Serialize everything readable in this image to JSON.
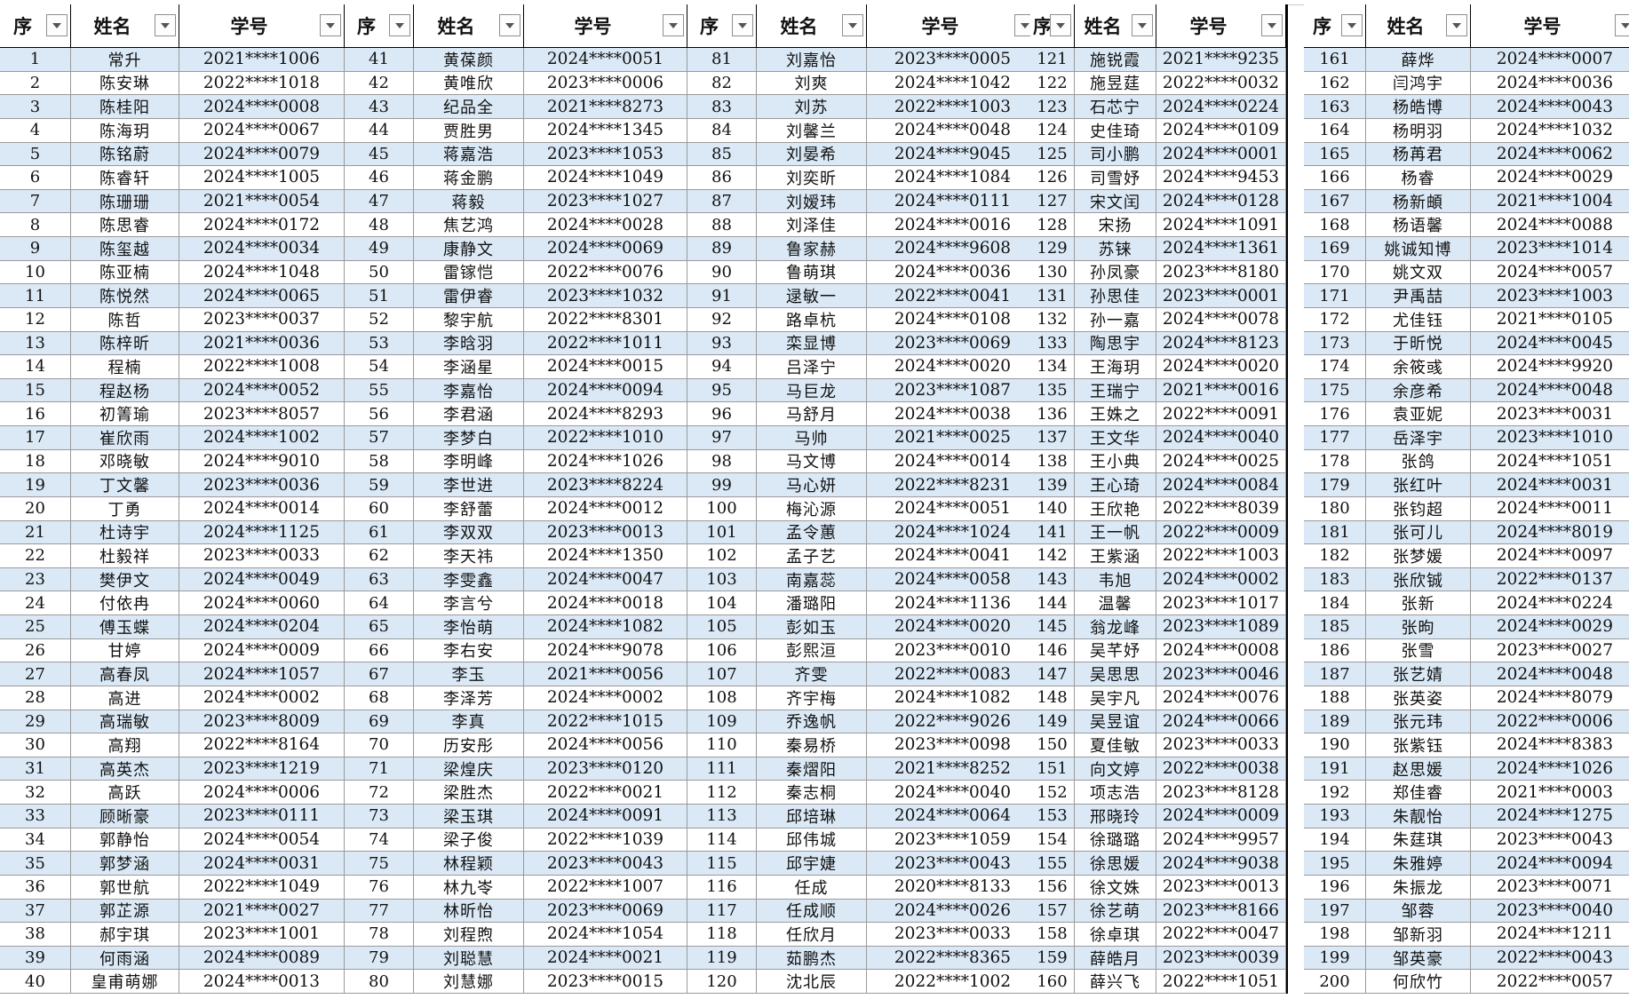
{
  "header": {
    "seq": "序",
    "name": "姓名",
    "id": "学号"
  },
  "accent": {
    "alt_row": "#dbe9f6",
    "border": "#000000"
  },
  "columns": [
    {
      "rows": [
        [
          "1",
          "常升",
          "2021****1006"
        ],
        [
          "2",
          "陈安琳",
          "2022****1018"
        ],
        [
          "3",
          "陈桂阳",
          "2024****0008"
        ],
        [
          "4",
          "陈海玥",
          "2024****0067"
        ],
        [
          "5",
          "陈铭蔚",
          "2024****0079"
        ],
        [
          "6",
          "陈睿轩",
          "2024****1005"
        ],
        [
          "7",
          "陈珊珊",
          "2021****0054"
        ],
        [
          "8",
          "陈思睿",
          "2024****0172"
        ],
        [
          "9",
          "陈玺越",
          "2024****0034"
        ],
        [
          "10",
          "陈亚楠",
          "2024****1048"
        ],
        [
          "11",
          "陈悦然",
          "2024****0065"
        ],
        [
          "12",
          "陈哲",
          "2023****0037"
        ],
        [
          "13",
          "陈梓昕",
          "2021****0036"
        ],
        [
          "14",
          "程楠",
          "2022****1008"
        ],
        [
          "15",
          "程赵杨",
          "2024****0052"
        ],
        [
          "16",
          "初箐瑜",
          "2023****8057"
        ],
        [
          "17",
          "崔欣雨",
          "2024****1002"
        ],
        [
          "18",
          "邓晓敏",
          "2024****9010"
        ],
        [
          "19",
          "丁文馨",
          "2023****0036"
        ],
        [
          "20",
          "丁勇",
          "2024****0014"
        ],
        [
          "21",
          "杜诗宇",
          "2024****1125"
        ],
        [
          "22",
          "杜毅祥",
          "2023****0033"
        ],
        [
          "23",
          "樊伊文",
          "2024****0049"
        ],
        [
          "24",
          "付依冉",
          "2024****0060"
        ],
        [
          "25",
          "傅玉蝶",
          "2024****0204"
        ],
        [
          "26",
          "甘婷",
          "2024****0009"
        ],
        [
          "27",
          "高春凤",
          "2024****1057"
        ],
        [
          "28",
          "高进",
          "2024****0002"
        ],
        [
          "29",
          "高瑞敏",
          "2023****8009"
        ],
        [
          "30",
          "高翔",
          "2022****8164"
        ],
        [
          "31",
          "高英杰",
          "2023****1219"
        ],
        [
          "32",
          "高跃",
          "2024****0006"
        ],
        [
          "33",
          "顾晰豪",
          "2023****0111"
        ],
        [
          "34",
          "郭静怡",
          "2024****0054"
        ],
        [
          "35",
          "郭梦涵",
          "2024****0031"
        ],
        [
          "36",
          "郭世航",
          "2022****1049"
        ],
        [
          "37",
          "郭芷源",
          "2021****0027"
        ],
        [
          "38",
          "郝宇琪",
          "2023****1001"
        ],
        [
          "39",
          "何雨涵",
          "2024****0089"
        ],
        [
          "40",
          "皇甫萌娜",
          "2024****0013"
        ]
      ]
    },
    {
      "rows": [
        [
          "41",
          "黄葆颜",
          "2024****0051"
        ],
        [
          "42",
          "黄唯欣",
          "2023****0006"
        ],
        [
          "43",
          "纪品全",
          "2021****8273"
        ],
        [
          "44",
          "贾胜男",
          "2024****1345"
        ],
        [
          "45",
          "蒋嘉浩",
          "2023****1053"
        ],
        [
          "46",
          "蒋金鹏",
          "2024****1049"
        ],
        [
          "47",
          "蒋毅",
          "2023****1027"
        ],
        [
          "48",
          "焦艺鸿",
          "2024****0028"
        ],
        [
          "49",
          "康静文",
          "2024****0069"
        ],
        [
          "50",
          "雷镓恺",
          "2022****0076"
        ],
        [
          "51",
          "雷伊睿",
          "2023****1032"
        ],
        [
          "52",
          "黎宇航",
          "2022****8301"
        ],
        [
          "53",
          "李晗羽",
          "2022****1011"
        ],
        [
          "54",
          "李涵星",
          "2024****0015"
        ],
        [
          "55",
          "李嘉怡",
          "2024****0094"
        ],
        [
          "56",
          "李君涵",
          "2024****8293"
        ],
        [
          "57",
          "李梦白",
          "2022****1010"
        ],
        [
          "58",
          "李明峰",
          "2024****1026"
        ],
        [
          "59",
          "李世进",
          "2023****8224"
        ],
        [
          "60",
          "李舒蕾",
          "2024****0012"
        ],
        [
          "61",
          "李双双",
          "2023****0013"
        ],
        [
          "62",
          "李天祎",
          "2024****1350"
        ],
        [
          "63",
          "李雯鑫",
          "2024****0047"
        ],
        [
          "64",
          "李言兮",
          "2024****0018"
        ],
        [
          "65",
          "李怡萌",
          "2024****1082"
        ],
        [
          "66",
          "李右安",
          "2024****9078"
        ],
        [
          "67",
          "李玉",
          "2021****0056"
        ],
        [
          "68",
          "李泽芳",
          "2024****0002"
        ],
        [
          "69",
          "李真",
          "2022****1015"
        ],
        [
          "70",
          "历安彤",
          "2024****0056"
        ],
        [
          "71",
          "梁煌庆",
          "2023****0120"
        ],
        [
          "72",
          "梁胜杰",
          "2022****0021"
        ],
        [
          "73",
          "梁玉琪",
          "2024****0091"
        ],
        [
          "74",
          "梁子俊",
          "2022****1039"
        ],
        [
          "75",
          "林程颖",
          "2023****0043"
        ],
        [
          "76",
          "林九岺",
          "2022****1007"
        ],
        [
          "77",
          "林昕怡",
          "2023****0069"
        ],
        [
          "78",
          "刘程煦",
          "2024****1054"
        ],
        [
          "79",
          "刘聪慧",
          "2024****0021"
        ],
        [
          "80",
          "刘慧娜",
          "2023****0015"
        ]
      ]
    },
    {
      "rows": [
        [
          "81",
          "刘嘉怡",
          "2023****0005"
        ],
        [
          "82",
          "刘爽",
          "2024****1042"
        ],
        [
          "83",
          "刘苏",
          "2022****1003"
        ],
        [
          "84",
          "刘馨兰",
          "2024****0048"
        ],
        [
          "85",
          "刘晏希",
          "2024****9045"
        ],
        [
          "86",
          "刘奕昕",
          "2024****1084"
        ],
        [
          "87",
          "刘嫒玮",
          "2024****0111"
        ],
        [
          "88",
          "刘泽佳",
          "2024****0016"
        ],
        [
          "89",
          "鲁家赫",
          "2024****9608"
        ],
        [
          "90",
          "鲁萌琪",
          "2024****0036"
        ],
        [
          "91",
          "逯敏一",
          "2022****0041"
        ],
        [
          "92",
          "路卓杭",
          "2024****0108"
        ],
        [
          "93",
          "栾显博",
          "2023****0069"
        ],
        [
          "94",
          "吕泽宁",
          "2024****0020"
        ],
        [
          "95",
          "马巨龙",
          "2023****1087"
        ],
        [
          "96",
          "马舒月",
          "2024****0038"
        ],
        [
          "97",
          "马帅",
          "2021****0025"
        ],
        [
          "98",
          "马文博",
          "2024****0014"
        ],
        [
          "99",
          "马心妍",
          "2022****8231"
        ],
        [
          "100",
          "梅沁源",
          "2024****0051"
        ],
        [
          "101",
          "孟令蕙",
          "2024****1024"
        ],
        [
          "102",
          "孟子艺",
          "2024****0041"
        ],
        [
          "103",
          "南嘉蕊",
          "2024****0058"
        ],
        [
          "104",
          "潘璐阳",
          "2024****1136"
        ],
        [
          "105",
          "彭如玉",
          "2024****0020"
        ],
        [
          "106",
          "彭熙洹",
          "2023****0010"
        ],
        [
          "107",
          "齐雯",
          "2022****0083"
        ],
        [
          "108",
          "齐宇梅",
          "2024****1082"
        ],
        [
          "109",
          "乔逸帆",
          "2022****9026"
        ],
        [
          "110",
          "秦易桥",
          "2023****0098"
        ],
        [
          "111",
          "秦熠阳",
          "2021****8252"
        ],
        [
          "112",
          "秦志桐",
          "2024****0040"
        ],
        [
          "113",
          "邱培琳",
          "2024****0064"
        ],
        [
          "114",
          "邱伟城",
          "2023****1059"
        ],
        [
          "115",
          "邱宇婕",
          "2023****0043"
        ],
        [
          "116",
          "任成",
          "2020****8133"
        ],
        [
          "117",
          "任成顺",
          "2024****0026"
        ],
        [
          "118",
          "任欣月",
          "2023****0033"
        ],
        [
          "119",
          "茹鹏杰",
          "2022****8365"
        ],
        [
          "120",
          "沈北辰",
          "2022****1002"
        ]
      ]
    },
    {
      "rows": [
        [
          "121",
          "施锐霞",
          "2021****9235"
        ],
        [
          "122",
          "施昱莛",
          "2022****0032"
        ],
        [
          "123",
          "石芯宁",
          "2024****0224"
        ],
        [
          "124",
          "史佳琦",
          "2024****0109"
        ],
        [
          "125",
          "司小鹏",
          "2024****0001"
        ],
        [
          "126",
          "司雪妤",
          "2024****9453"
        ],
        [
          "127",
          "宋文闰",
          "2024****0128"
        ],
        [
          "128",
          "宋扬",
          "2024****1091"
        ],
        [
          "129",
          "苏铼",
          "2024****1361"
        ],
        [
          "130",
          "孙凤豪",
          "2023****8180"
        ],
        [
          "131",
          "孙思佳",
          "2023****0001"
        ],
        [
          "132",
          "孙一嘉",
          "2024****0078"
        ],
        [
          "133",
          "陶思宇",
          "2024****8123"
        ],
        [
          "134",
          "王海玥",
          "2024****0020"
        ],
        [
          "135",
          "王瑞宁",
          "2021****0016"
        ],
        [
          "136",
          "王姝之",
          "2022****0091"
        ],
        [
          "137",
          "王文华",
          "2024****0040"
        ],
        [
          "138",
          "王小典",
          "2024****0025"
        ],
        [
          "139",
          "王心琦",
          "2024****0084"
        ],
        [
          "140",
          "王欣艳",
          "2022****8039"
        ],
        [
          "141",
          "王一帆",
          "2022****0009"
        ],
        [
          "142",
          "王紫涵",
          "2022****1003"
        ],
        [
          "143",
          "韦旭",
          "2024****0002"
        ],
        [
          "144",
          "温馨",
          "2023****1017"
        ],
        [
          "145",
          "翁龙峰",
          "2023****1089"
        ],
        [
          "146",
          "吴芊妤",
          "2024****0008"
        ],
        [
          "147",
          "吴思思",
          "2023****0046"
        ],
        [
          "148",
          "吴宇凡",
          "2024****0076"
        ],
        [
          "149",
          "吴昱谊",
          "2024****0066"
        ],
        [
          "150",
          "夏佳敏",
          "2023****0033"
        ],
        [
          "151",
          "向文婷",
          "2022****0038"
        ],
        [
          "152",
          "项志浩",
          "2023****8128"
        ],
        [
          "153",
          "邢晓玲",
          "2024****0009"
        ],
        [
          "154",
          "徐璐璐",
          "2024****9957"
        ],
        [
          "155",
          "徐思媛",
          "2024****9038"
        ],
        [
          "156",
          "徐文姝",
          "2023****0013"
        ],
        [
          "157",
          "徐艺萌",
          "2023****8166"
        ],
        [
          "158",
          "徐卓琪",
          "2022****0047"
        ],
        [
          "159",
          "薛皓月",
          "2023****0039"
        ],
        [
          "160",
          "薛兴飞",
          "2022****1051"
        ]
      ]
    },
    {
      "rows": [
        [
          "161",
          "薛烨",
          "2024****0007"
        ],
        [
          "162",
          "闫鸿宇",
          "2024****0036"
        ],
        [
          "163",
          "杨皓博",
          "2024****0043"
        ],
        [
          "164",
          "杨明羽",
          "2024****1032"
        ],
        [
          "165",
          "杨苒君",
          "2024****0062"
        ],
        [
          "166",
          "杨睿",
          "2024****0029"
        ],
        [
          "167",
          "杨新頔",
          "2021****1004"
        ],
        [
          "168",
          "杨语馨",
          "2024****0088"
        ],
        [
          "169",
          "姚诚知博",
          "2023****1014"
        ],
        [
          "170",
          "姚文双",
          "2024****0057"
        ],
        [
          "171",
          "尹禹喆",
          "2023****1003"
        ],
        [
          "172",
          "尤佳钰",
          "2021****0105"
        ],
        [
          "173",
          "于昕悦",
          "2024****0045"
        ],
        [
          "174",
          "余筱彧",
          "2024****9920"
        ],
        [
          "175",
          "余彦希",
          "2024****0048"
        ],
        [
          "176",
          "袁亚妮",
          "2023****0031"
        ],
        [
          "177",
          "岳泽宇",
          "2023****1010"
        ],
        [
          "178",
          "张鸽",
          "2024****1051"
        ],
        [
          "179",
          "张红叶",
          "2024****0031"
        ],
        [
          "180",
          "张钧超",
          "2024****0011"
        ],
        [
          "181",
          "张可儿",
          "2024****8019"
        ],
        [
          "182",
          "张梦媛",
          "2024****0097"
        ],
        [
          "183",
          "张欣铖",
          "2022****0137"
        ],
        [
          "184",
          "张新",
          "2024****0224"
        ],
        [
          "185",
          "张昫",
          "2024****0029"
        ],
        [
          "186",
          "张雪",
          "2023****0027"
        ],
        [
          "187",
          "张艺婧",
          "2024****0048"
        ],
        [
          "188",
          "张英姿",
          "2024****8079"
        ],
        [
          "189",
          "张元玮",
          "2022****0006"
        ],
        [
          "190",
          "张紫钰",
          "2024****8383"
        ],
        [
          "191",
          "赵思媛",
          "2024****1026"
        ],
        [
          "192",
          "郑佳睿",
          "2021****0003"
        ],
        [
          "193",
          "朱靓怡",
          "2024****1275"
        ],
        [
          "194",
          "朱莛琪",
          "2023****0043"
        ],
        [
          "195",
          "朱雅婷",
          "2024****0094"
        ],
        [
          "196",
          "朱振龙",
          "2023****0071"
        ],
        [
          "197",
          "邹蓉",
          "2023****0040"
        ],
        [
          "198",
          "邹新羽",
          "2024****1211"
        ],
        [
          "199",
          "邹英豪",
          "2022****0043"
        ],
        [
          "200",
          "何欣竹",
          "2022****0057"
        ]
      ]
    }
  ]
}
